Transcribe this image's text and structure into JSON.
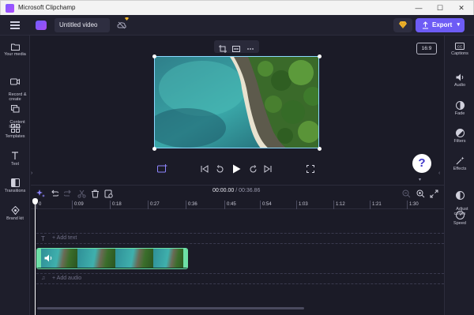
{
  "window": {
    "title": "Microsoft Clipchamp",
    "controls": [
      "—",
      "☐",
      "✕"
    ]
  },
  "header": {
    "project_title": "Untitled video",
    "export_label": "Export"
  },
  "left_nav": [
    {
      "id": "your-media",
      "label": "Your media"
    },
    {
      "id": "record-create",
      "label": "Record &\ncreate"
    },
    {
      "id": "content-library",
      "label": "Content\nlibrary"
    },
    {
      "id": "templates",
      "label": "Templates"
    },
    {
      "id": "text",
      "label": "Text"
    },
    {
      "id": "transitions",
      "label": "Transitions"
    },
    {
      "id": "brand-kit",
      "label": "Brand kit"
    }
  ],
  "right_nav": [
    {
      "id": "captions",
      "label": "Captions"
    },
    {
      "id": "audio",
      "label": "Audio"
    },
    {
      "id": "fade",
      "label": "Fade"
    },
    {
      "id": "filters",
      "label": "Filters"
    },
    {
      "id": "effects",
      "label": "Effects"
    },
    {
      "id": "adjust-colors",
      "label": "Adjust\ncolors"
    },
    {
      "id": "speed",
      "label": "Speed"
    }
  ],
  "preview": {
    "aspect_ratio": "16:9"
  },
  "help": {
    "label": "?"
  },
  "timeline": {
    "current_time": "00:00.00",
    "separator": " / ",
    "total_time": "00:36.86",
    "ruler_ticks": [
      "0",
      "0:09",
      "0:18",
      "0:27",
      "0:36",
      "0:45",
      "0:54",
      "1:03",
      "1:12",
      "1:21",
      "1:30"
    ],
    "text_track_label": "+ Add text",
    "audio_track_label": "+ Add audio"
  },
  "colors": {
    "accent": "#6d5cf5",
    "clip_border": "#6ee0a7",
    "preview_border": "#8ad8ff",
    "background": "#1b1b27"
  }
}
